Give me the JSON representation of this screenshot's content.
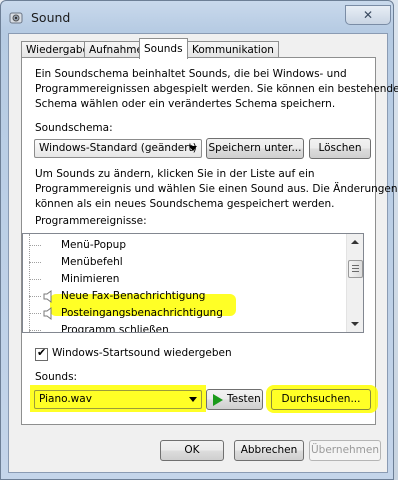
{
  "window": {
    "title": "Sound",
    "close_glyph": "✕"
  },
  "tabs": [
    "Wiedergabe",
    "Aufnahme",
    "Sounds",
    "Kommunikation"
  ],
  "active_tab": "Sounds",
  "intro": [
    "Ein Soundschema beinhaltet Sounds, die bei Windows- und",
    "Programmereignissen abgespielt werden. Sie können ein bestehendes",
    "Schema wählen oder ein verändertes Schema speichern."
  ],
  "scheme": {
    "label": "Soundschema:",
    "value": "Windows-Standard (geändert)",
    "save_button": "Speichern unter...",
    "delete_button": "Löschen"
  },
  "instructions": [
    "Um Sounds zu ändern, klicken Sie in der Liste auf ein",
    "Programmereignis und wählen Sie einen Sound aus. Die Änderungen",
    "können als ein neues Soundschema gespeichert werden."
  ],
  "events": {
    "label": "Programmereignisse:",
    "items": [
      {
        "label": "Menü-Popup",
        "has_sound": false
      },
      {
        "label": "Menübefehl",
        "has_sound": false
      },
      {
        "label": "Minimieren",
        "has_sound": false
      },
      {
        "label": "Neue Fax-Benachrichtigung",
        "has_sound": true
      },
      {
        "label": "Posteingangsbenachrichtigung",
        "has_sound": true,
        "highlighted": true
      },
      {
        "label": "Programm schließen",
        "has_sound": false
      }
    ]
  },
  "startup_sound": {
    "label": "Windows-Startsound wiedergeben",
    "checked": true
  },
  "sounds": {
    "label": "Sounds:",
    "value": "Piano.wav",
    "test_button": "Testen",
    "browse_button": "Durchsuchen..."
  },
  "footer": {
    "ok": "OK",
    "cancel": "Abbrechen",
    "apply": "Übernehmen"
  },
  "colors": {
    "highlight": "#ffff00",
    "play_icon": "#1a9a1a",
    "titlebar": "#c0d3ea"
  }
}
